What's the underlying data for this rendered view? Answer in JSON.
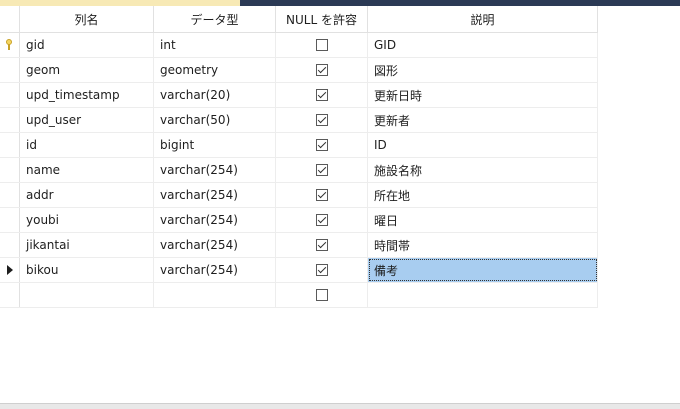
{
  "header": {
    "col_name": "列名",
    "col_type": "データ型",
    "col_null": "NULL を許容",
    "col_desc": "説明"
  },
  "rows": [
    {
      "name": "gid",
      "type": "int",
      "nullable": false,
      "desc": "GID",
      "primary_key": true
    },
    {
      "name": "geom",
      "type": "geometry",
      "nullable": true,
      "desc": "図形"
    },
    {
      "name": "upd_timestamp",
      "type": "varchar(20)",
      "nullable": true,
      "desc": "更新日時"
    },
    {
      "name": "upd_user",
      "type": "varchar(50)",
      "nullable": true,
      "desc": "更新者"
    },
    {
      "name": "id",
      "type": "bigint",
      "nullable": true,
      "desc": "ID"
    },
    {
      "name": "name",
      "type": "varchar(254)",
      "nullable": true,
      "desc": "施設名称"
    },
    {
      "name": "addr",
      "type": "varchar(254)",
      "nullable": true,
      "desc": "所在地"
    },
    {
      "name": "youbi",
      "type": "varchar(254)",
      "nullable": true,
      "desc": "曜日"
    },
    {
      "name": "jikantai",
      "type": "varchar(254)",
      "nullable": true,
      "desc": "時間帯"
    },
    {
      "name": "bikou",
      "type": "varchar(254)",
      "nullable": true,
      "desc": "備考",
      "current": true
    }
  ],
  "new_row": {
    "nullable": false
  },
  "icons": {
    "primary_key": "key-icon",
    "current_row": "row-arrow-icon"
  },
  "colors": {
    "selection": "#a8cdf0",
    "top_left_accent": "#f7e9b5",
    "top_right_accent": "#2b3a55"
  }
}
